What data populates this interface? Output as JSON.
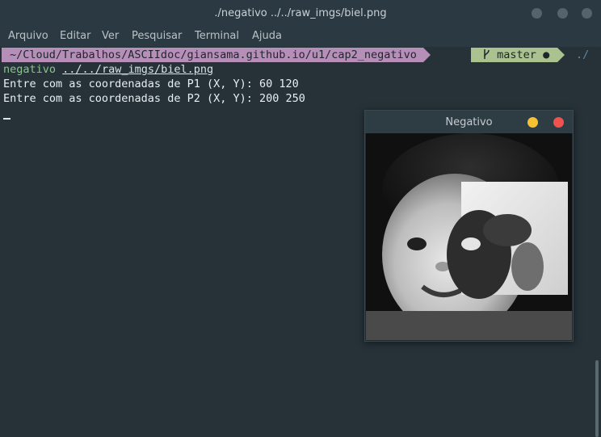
{
  "window": {
    "title": "./negativo ../../raw_imgs/biel.png"
  },
  "menu": [
    "Arquivo",
    "Editar",
    "Ver",
    "Pesquisar",
    "Terminal",
    "Ajuda"
  ],
  "prompt": {
    "path": "~/Cloud/Trabalhos/ASCIIdoc/giansama.github.io/u1/cap2_negativo",
    "branch_icon": "git-branch-icon",
    "branch": "master",
    "dirty_marker": "●",
    "trailing": "./"
  },
  "terminal": {
    "command": "negativo",
    "argument": "../../raw_imgs/biel.png",
    "output_lines": [
      "Entre com as coordenadas de P1 (X, Y): 60 120",
      "Entre com as coordenadas de P2 (X, Y): 200 250"
    ]
  },
  "image_window": {
    "title": "Negativo",
    "minimize_color": "#f5c033",
    "close_color": "#ef5350"
  }
}
